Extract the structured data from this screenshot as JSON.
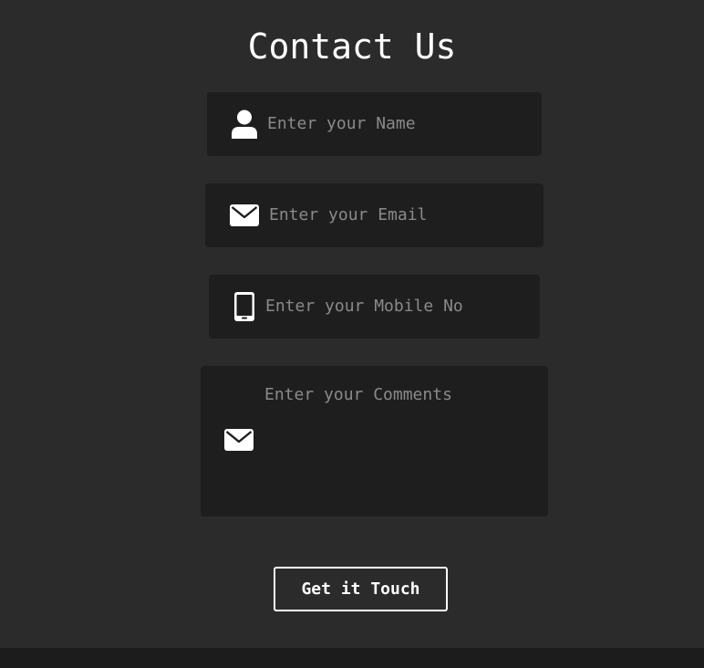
{
  "form": {
    "title": "Contact Us",
    "fields": {
      "name": {
        "placeholder": "Enter your Name",
        "icon": "user-icon"
      },
      "email": {
        "placeholder": "Enter your Email",
        "icon": "envelope-icon"
      },
      "mobile": {
        "placeholder": "Enter your Mobile No",
        "icon": "mobile-phone-icon"
      },
      "comments": {
        "placeholder": "Enter your Comments",
        "icon": "envelope-icon"
      }
    },
    "submit_label": "Get it Touch"
  },
  "colors": {
    "background": "#2b2b2b",
    "field_background": "#1e1e1e",
    "placeholder": "#8a8a8a",
    "text": "#ffffff",
    "footer": "#1c1c1c"
  }
}
